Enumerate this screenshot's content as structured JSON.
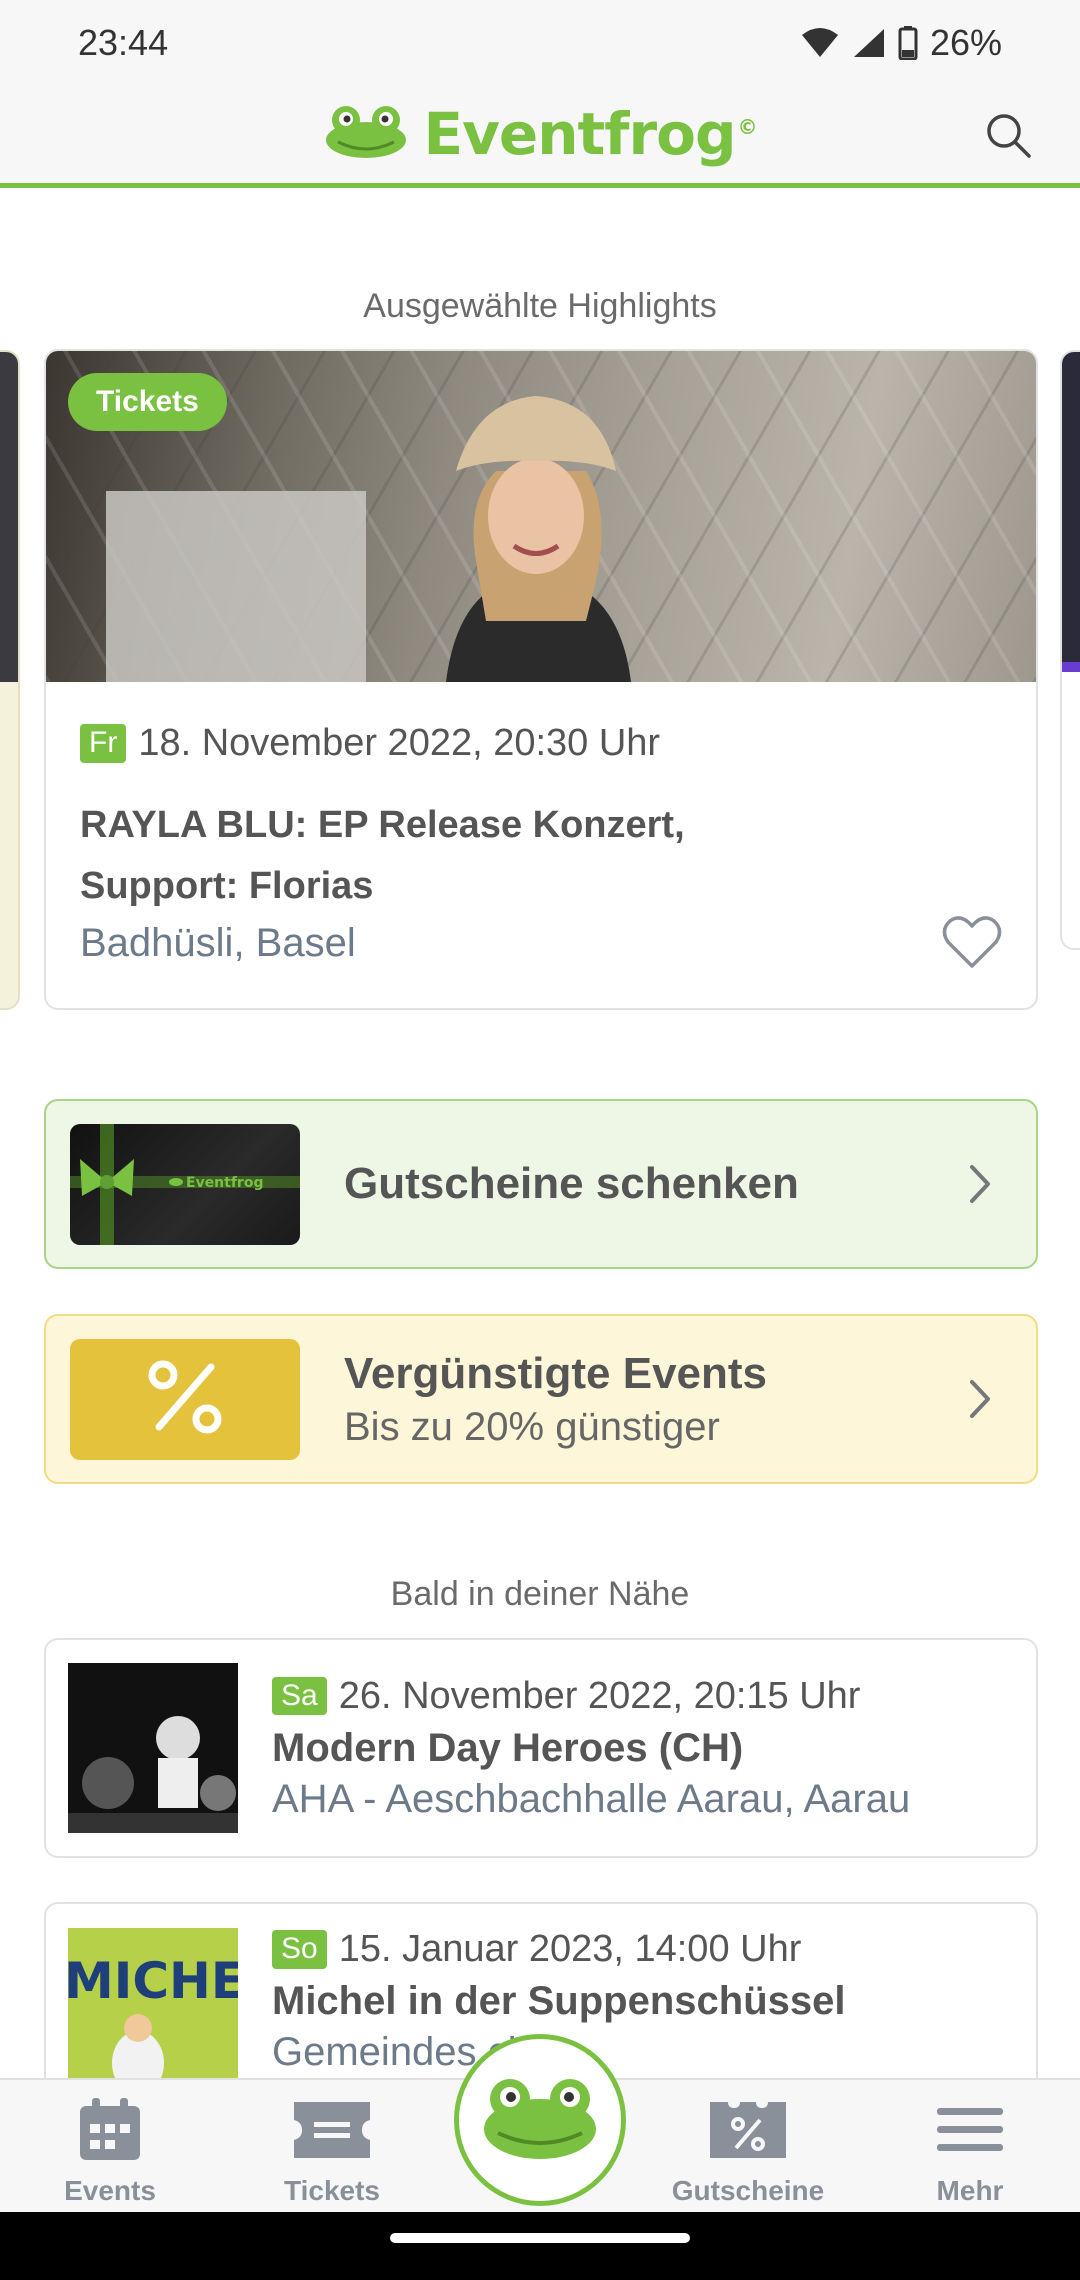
{
  "status_bar": {
    "time": "23:44",
    "battery": "26%"
  },
  "header": {
    "brand": "Eventfrog",
    "copyright": "©"
  },
  "highlights": {
    "section_title": "Ausgewählte Highlights",
    "card": {
      "badge": "Tickets",
      "day": "Fr",
      "date": "18. November 2022, 20:30 Uhr",
      "title": "RAYLA BLU: EP Release Konzert, Support: Florias",
      "venue": "Badhüsli, Basel"
    }
  },
  "promos": {
    "voucher": {
      "title": "Gutscheine schenken",
      "thumb_brand": "Eventfrog"
    },
    "discount": {
      "title": "Vergünstigte Events",
      "subtitle": "Bis zu 20% günstiger",
      "icon_text": "%"
    }
  },
  "nearby": {
    "section_title": "Bald in deiner Nähe",
    "events": [
      {
        "day": "Sa",
        "date": "26. November 2022, 20:15 Uhr",
        "title": "Modern Day Heroes (CH)",
        "venue": "AHA - Aeschbachhalle Aarau, Aarau"
      },
      {
        "day": "So",
        "date": "15. Januar 2023, 14:00 Uhr",
        "title": "Michel in der Suppenschüssel",
        "venue": "Gemeindes chs",
        "thumb_text": "MICHEL"
      }
    ]
  },
  "bottom_nav": {
    "events": "Events",
    "tickets": "Tickets",
    "gutscheine": "Gutscheine",
    "mehr": "Mehr"
  },
  "colors": {
    "brand_green": "#7ac142",
    "discount_yellow": "#e5c23c",
    "nav_gray": "#8a9099"
  }
}
